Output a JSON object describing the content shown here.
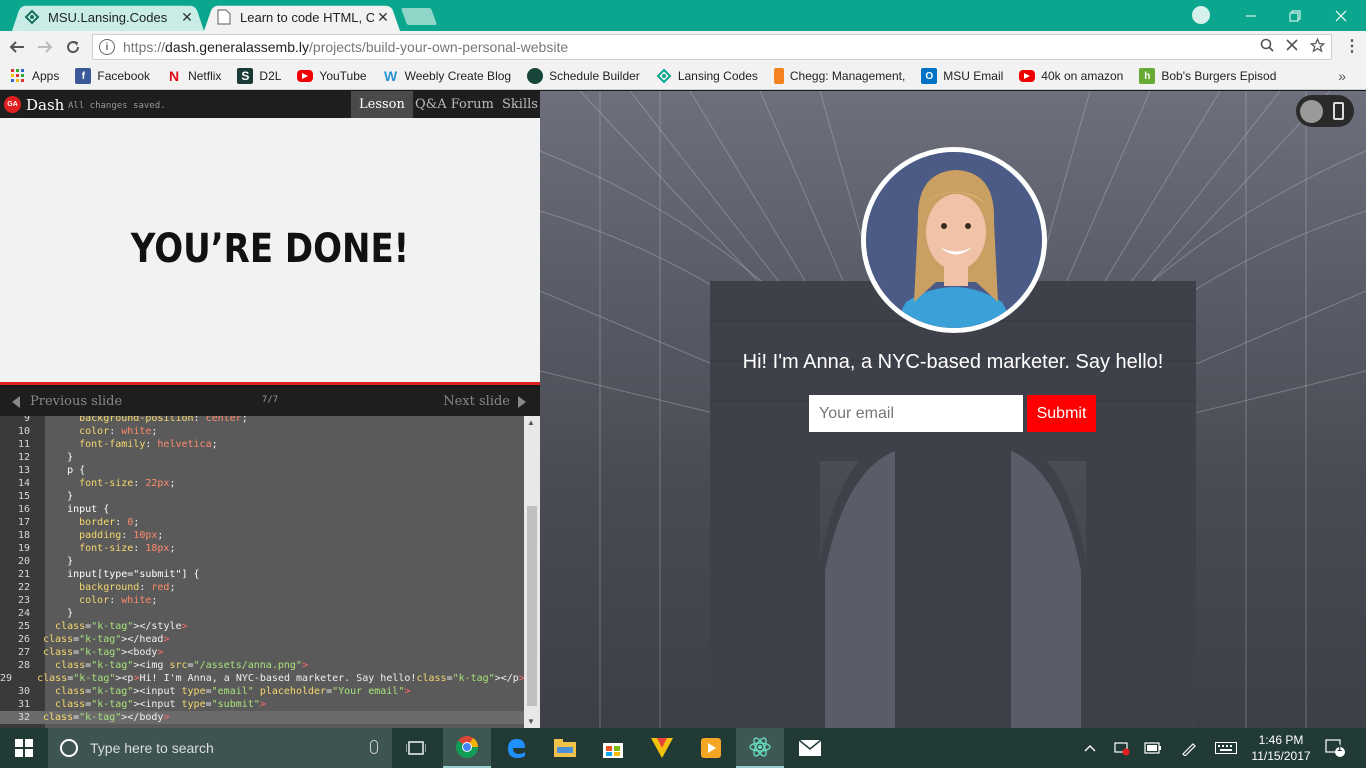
{
  "browser": {
    "tabs": [
      {
        "label": "MSU.Lansing.Codes",
        "close": "✕"
      },
      {
        "label": "Learn to code HTML, CSS",
        "close": "✕"
      }
    ],
    "url": {
      "scheme": "https://",
      "host": "dash.generalassemb.ly",
      "path": "/projects/build-your-own-personal-website"
    },
    "bookmarks": [
      {
        "label": "Apps",
        "icon": "apps-grid-icon",
        "color": "#e44"
      },
      {
        "label": "Facebook",
        "icon": "facebook-icon",
        "color": "#3b5998"
      },
      {
        "label": "Netflix",
        "icon": "netflix-icon",
        "color": "#e50914"
      },
      {
        "label": "D2L",
        "icon": "d2l-icon",
        "color": "#222"
      },
      {
        "label": "YouTube",
        "icon": "youtube-icon",
        "color": "#e00"
      },
      {
        "label": "Weebly Create Blog",
        "icon": "weebly-icon",
        "color": "#2a93d5"
      },
      {
        "label": "Schedule Builder",
        "icon": "spartan-icon",
        "color": "#18453b"
      },
      {
        "label": "Lansing Codes",
        "icon": "lansing-codes-icon",
        "color": "#0aa78e"
      },
      {
        "label": "Chegg: Management,",
        "icon": "chegg-icon",
        "color": "#f58220"
      },
      {
        "label": "MSU Email",
        "icon": "outlook-icon",
        "color": "#0072c6"
      },
      {
        "label": "40k on amazon",
        "icon": "youtube-icon",
        "color": "#e00"
      },
      {
        "label": "Bob's Burgers Episod",
        "icon": "hulu-icon",
        "color": "#66aa33"
      }
    ],
    "more": "»"
  },
  "dash": {
    "logo": "GA",
    "title": "Dash",
    "status": "All changes saved.",
    "tabs": [
      "Lesson",
      "Q&A Forum",
      "Skills"
    ],
    "slide_heading": "YOU’RE DONE!",
    "prev_label": "Previous slide",
    "next_label": "Next slide",
    "counter": "7/7"
  },
  "code_lines": [
    {
      "n": "9",
      "t": "      background-position: center;"
    },
    {
      "n": "10",
      "t": "      color: white;"
    },
    {
      "n": "11",
      "t": "      font-family: helvetica;"
    },
    {
      "n": "12",
      "t": "    }"
    },
    {
      "n": "13",
      "t": "    p {"
    },
    {
      "n": "14",
      "t": "      font-size: 22px;"
    },
    {
      "n": "15",
      "t": "    }"
    },
    {
      "n": "16",
      "t": "    input {"
    },
    {
      "n": "17",
      "t": "      border: 0;"
    },
    {
      "n": "18",
      "t": "      padding: 10px;"
    },
    {
      "n": "19",
      "t": "      font-size: 18px;"
    },
    {
      "n": "20",
      "t": "    }"
    },
    {
      "n": "21",
      "t": "    input[type=\"submit\"] {"
    },
    {
      "n": "22",
      "t": "      background: red;"
    },
    {
      "n": "23",
      "t": "      color: white;"
    },
    {
      "n": "24",
      "t": "    }"
    },
    {
      "n": "25",
      "t": "  </style>"
    },
    {
      "n": "26",
      "t": "</head>"
    },
    {
      "n": "27",
      "t": "<body>"
    },
    {
      "n": "28",
      "t": "  <img src=\"/assets/anna.png\">"
    },
    {
      "n": "29",
      "t": "  <p>Hi! I'm Anna, a NYC-based marketer. Say hello!</p>"
    },
    {
      "n": "30",
      "t": "  <input type=\"email\" placeholder=\"Your email\">"
    },
    {
      "n": "31",
      "t": "  <input type=\"submit\">"
    },
    {
      "n": "32",
      "t": "</body>"
    }
  ],
  "preview": {
    "greeting": "Hi! I'm Anna, a NYC-based marketer. Say hello!",
    "email_placeholder": "Your email",
    "submit_label": "Submit"
  },
  "taskbar": {
    "search_placeholder": "Type here to search",
    "time": "1:46 PM",
    "date": "11/15/2017",
    "notification_count": "1"
  },
  "colors": {
    "chrome_frame": "#0aa78e",
    "submit_red": "#ff0000",
    "ga_red": "#e02020"
  }
}
